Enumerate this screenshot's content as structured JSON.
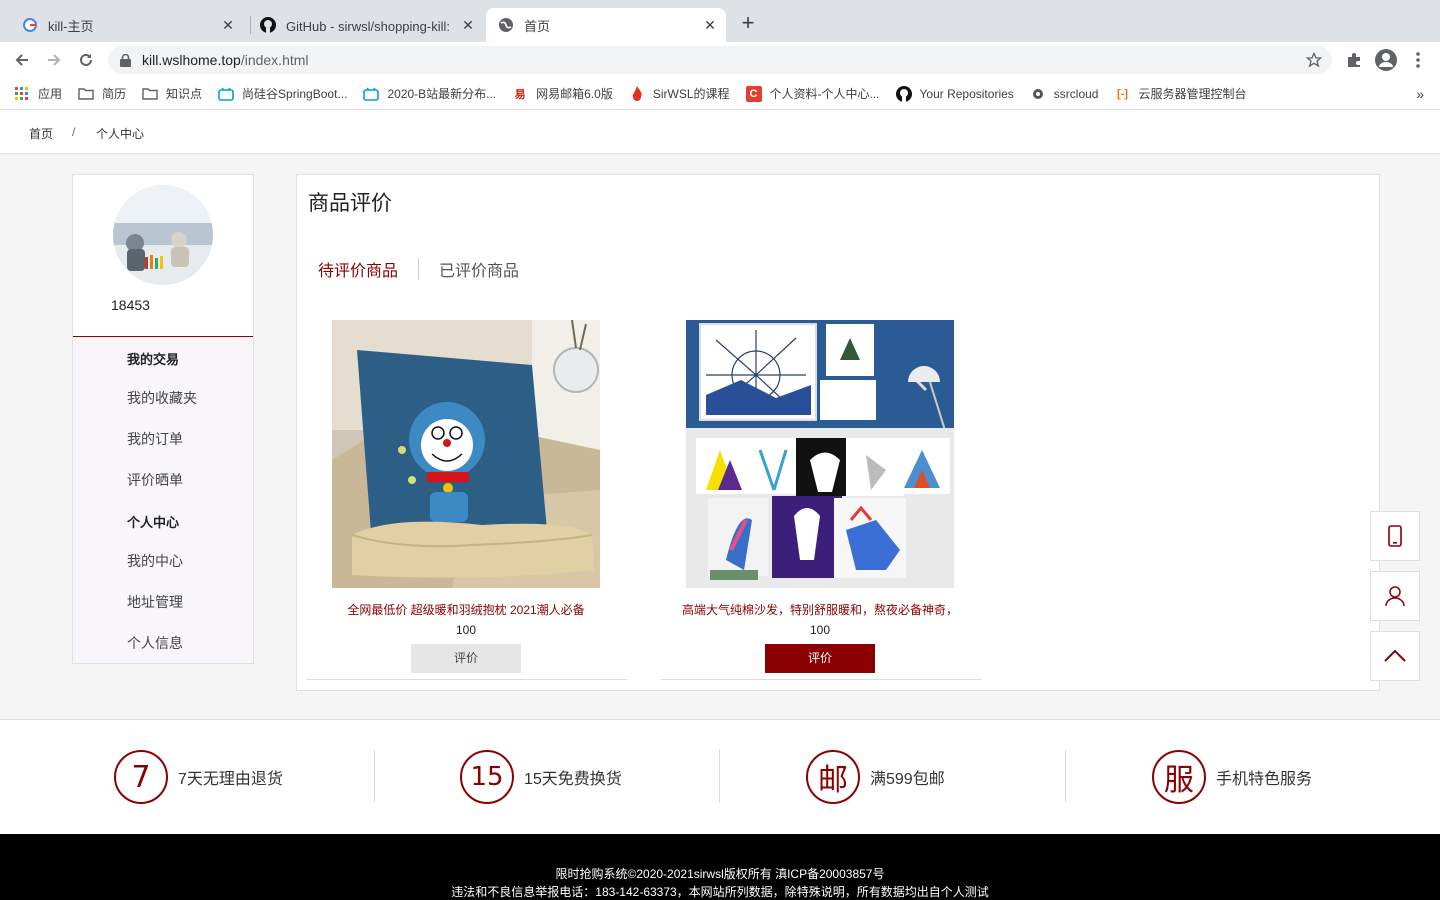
{
  "browser": {
    "tabs": [
      {
        "title": "kill-主页",
        "icon": "google-icon"
      },
      {
        "title": "GitHub - sirwsl/shopping-kill: 阿",
        "icon": "github-icon"
      },
      {
        "title": "首页",
        "icon": "globe-icon"
      }
    ],
    "url_host": "kill.wslhome.top",
    "url_path": "/index.html",
    "bookmarks": [
      "应用",
      "简历",
      "知识点",
      "尚硅谷SpringBoot...",
      "2020-B站最新分布...",
      "网易邮箱6.0版",
      "SirWSL的课程",
      "个人资料-个人中心...",
      "Your Repositories",
      "ssrcloud",
      "云服务器管理控制台"
    ],
    "more_bookmarks": "»"
  },
  "breadcrumb": {
    "home": "首页",
    "sep": "/",
    "current": "个人中心"
  },
  "user": {
    "name": "18453"
  },
  "menu": {
    "trade_head": "我的交易",
    "favorites": "我的收藏夹",
    "orders": "我的订单",
    "reviews": "评价晒单",
    "personal_head": "个人中心",
    "my_center": "我的中心",
    "address": "地址管理",
    "info": "个人信息"
  },
  "main": {
    "title": "商品评价",
    "tab_pending": "待评价商品",
    "tab_done": "已评价商品"
  },
  "products": [
    {
      "name": "全网最低价 超级暖和羽绒抱枕 2021潮人必备",
      "price": "100",
      "button": "评价"
    },
    {
      "name": "高端大气纯棉沙发，特别舒服暖和，熬夜必备神奇，",
      "price": "100",
      "button": "评价"
    }
  ],
  "services": [
    {
      "badge": "7",
      "text": "7天无理由退货"
    },
    {
      "badge": "15",
      "text": "15天免费换货"
    },
    {
      "badge": "邮",
      "text": "满599包邮"
    },
    {
      "badge": "服",
      "text": "手机特色服务"
    }
  ],
  "footer": {
    "line1": "限时抢购系统©2020-2021sirwsl版权所有 滇ICP备20003857号",
    "line2": "违法和不良信息举报电话：183-142-63373，本网站所列数据，除特殊说明，所有数据均出自个人测试"
  }
}
